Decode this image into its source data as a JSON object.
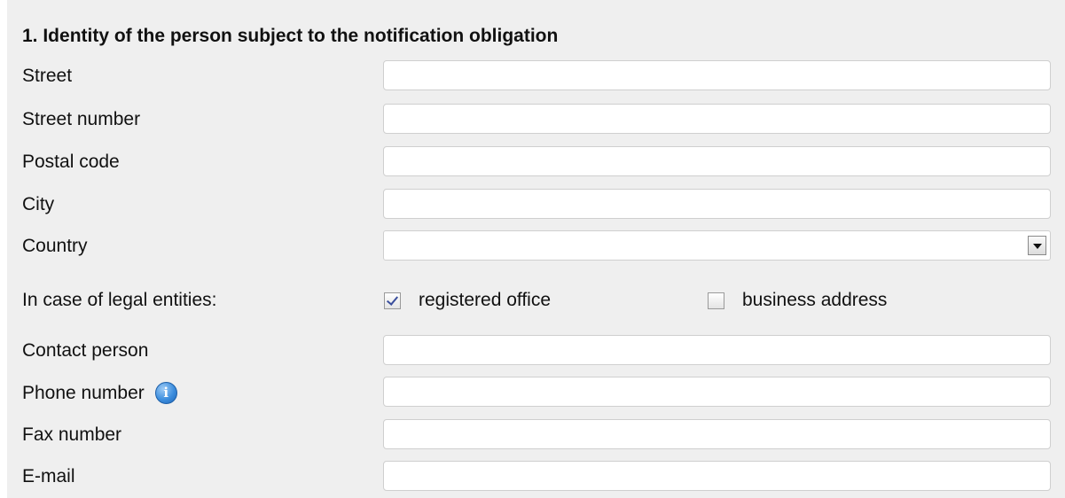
{
  "section": {
    "title": "1. Identity of the person subject to the notification obligation"
  },
  "fields": {
    "street": {
      "label": "Street",
      "value": ""
    },
    "street_number": {
      "label": "Street number",
      "value": ""
    },
    "postal_code": {
      "label": "Postal code",
      "value": ""
    },
    "city": {
      "label": "City",
      "value": ""
    },
    "country": {
      "label": "Country",
      "value": ""
    },
    "contact_person": {
      "label": "Contact person",
      "value": ""
    },
    "phone_number": {
      "label": "Phone number",
      "value": "",
      "info_icon": "info-icon"
    },
    "fax_number": {
      "label": "Fax number",
      "value": ""
    },
    "email": {
      "label": "E-mail",
      "value": ""
    }
  },
  "legal_entities": {
    "label": "In case of legal entities:",
    "registered_office": {
      "label": "registered office",
      "checked": true
    },
    "business_address": {
      "label": "business address",
      "checked": false
    }
  },
  "colors": {
    "panel_background": "#efefef",
    "info_icon": "#3d8ede",
    "checkmark": "#3a4e9c"
  }
}
